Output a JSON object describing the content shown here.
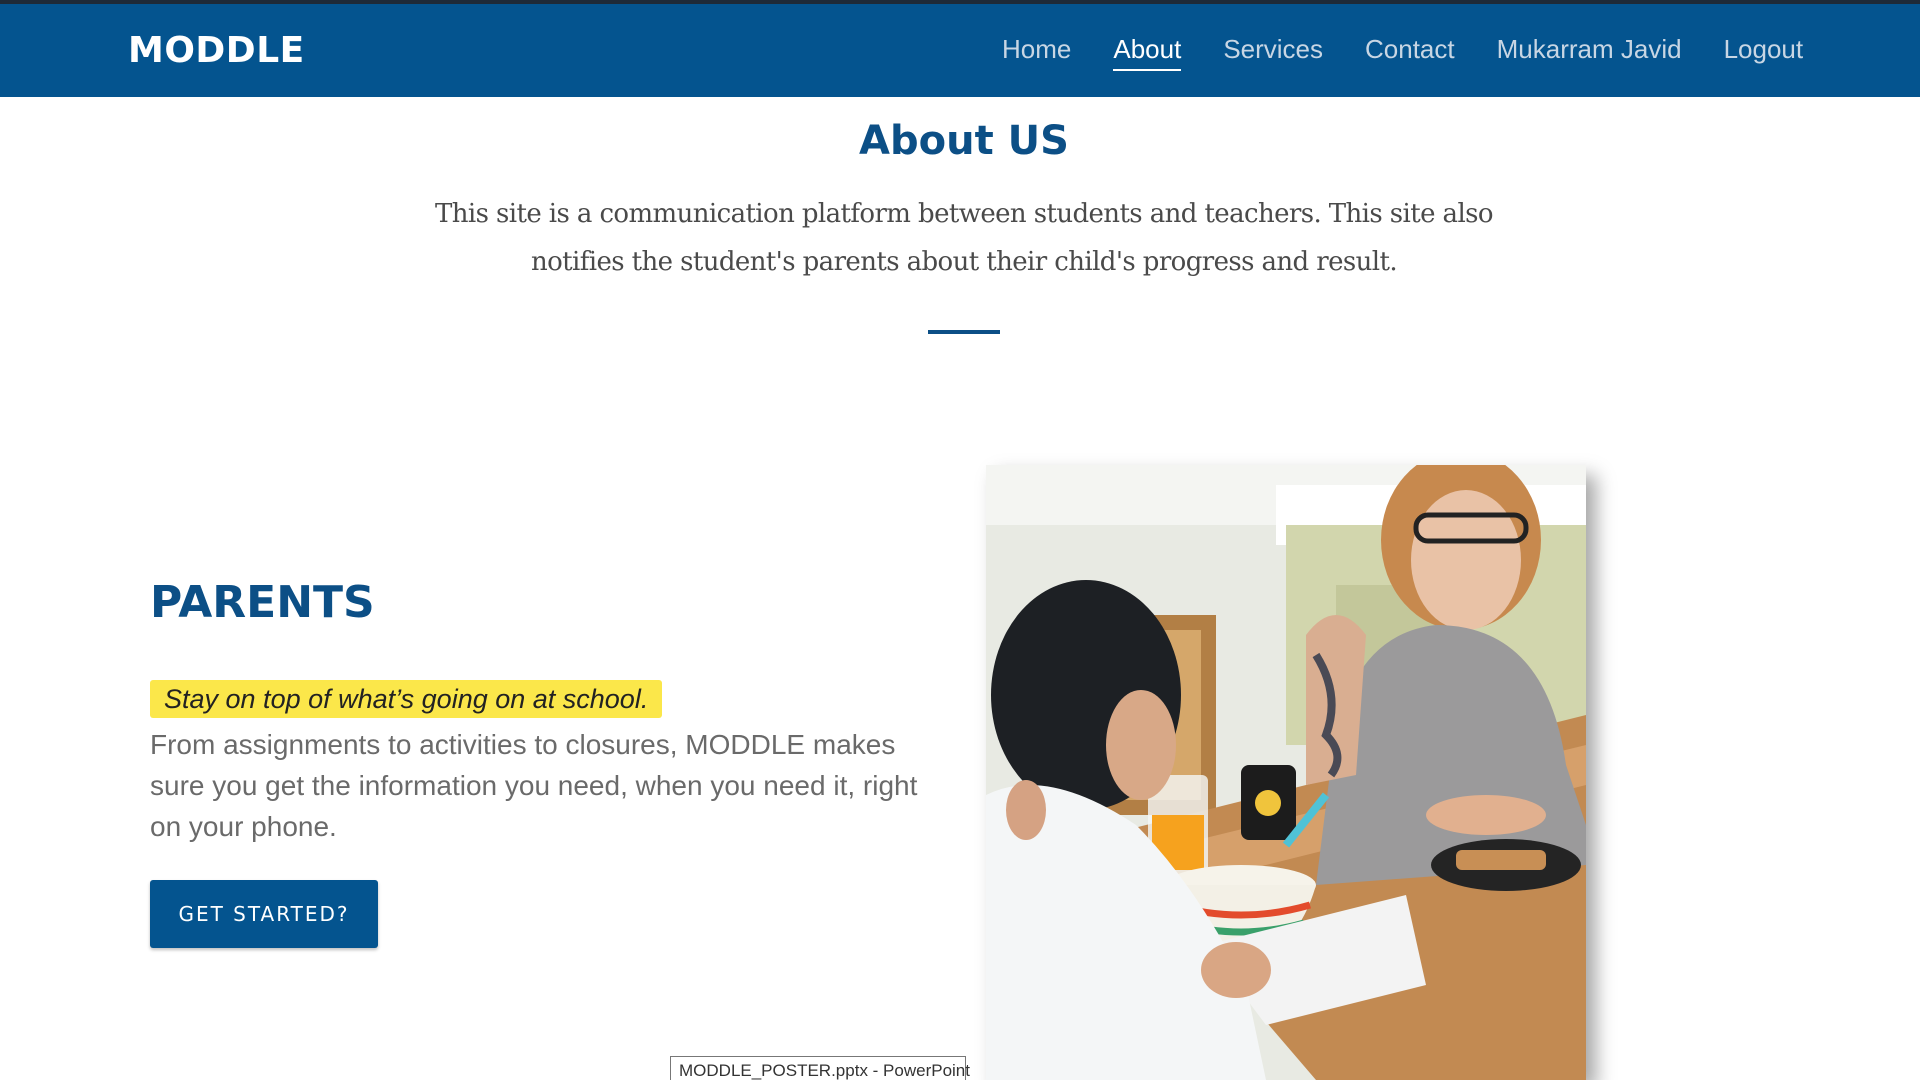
{
  "navbar": {
    "brand": "MODDLE",
    "links": [
      {
        "label": "Home",
        "active": false
      },
      {
        "label": "About",
        "active": true
      },
      {
        "label": "Services",
        "active": false
      },
      {
        "label": "Contact",
        "active": false
      },
      {
        "label": "Mukarram Javid",
        "active": false
      },
      {
        "label": "Logout",
        "active": false
      }
    ]
  },
  "about": {
    "title": "About US",
    "text": "This site is a communication platform between students and teachers. This site also notifies the student's parents about their child's progress and result."
  },
  "parents": {
    "title": "PARENTS",
    "highlight": "Stay on top of what’s going on at school.",
    "description": "From assignments to activities to closures, MODDLE makes sure you get the information you need, when you need it, right on your phone.",
    "button_label": "GET STARTED?"
  },
  "photo": {
    "icon": "parent-child-breakfast-photo"
  },
  "tooltip": {
    "text": "MODDLE_POSTER.pptx - PowerPoint"
  },
  "colors": {
    "primary": "#04548f",
    "heading": "#0c4f86",
    "highlight": "#fbe74a"
  }
}
